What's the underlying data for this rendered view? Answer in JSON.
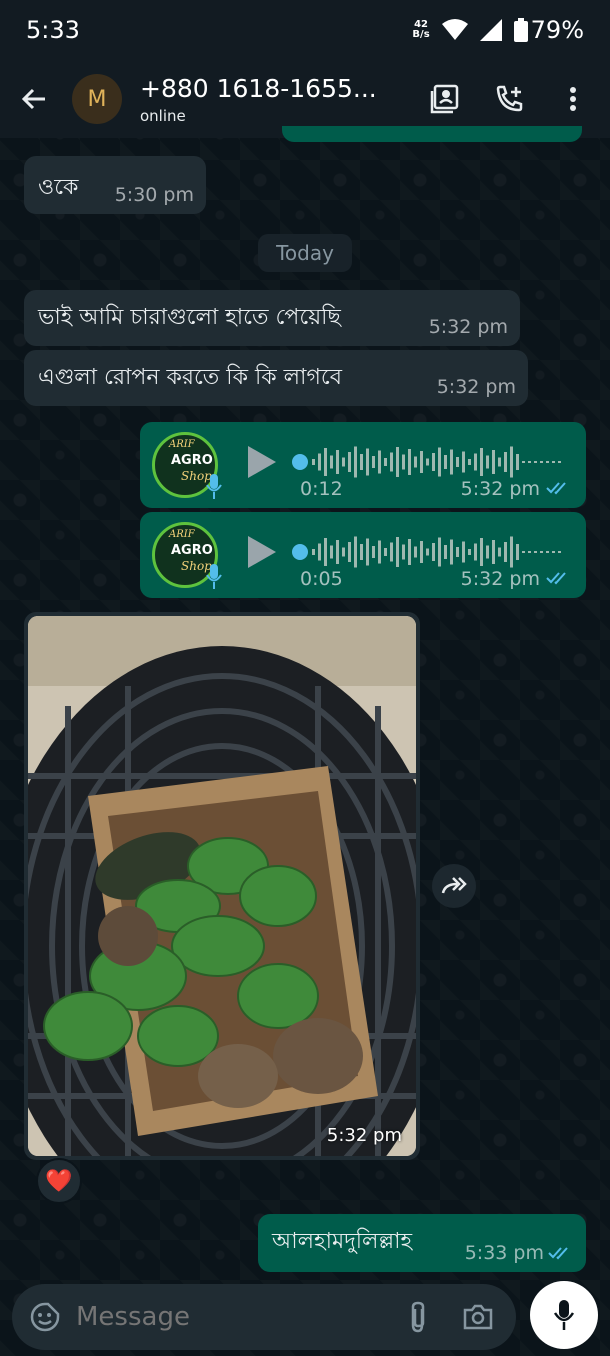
{
  "status_bar": {
    "time": "5:33",
    "net_speed_value": "42",
    "net_speed_unit": "B/s",
    "battery": "79%"
  },
  "header": {
    "avatar_letter": "M",
    "title": "+880 1618-1655...",
    "subtitle": "online"
  },
  "messages": {
    "m1": {
      "text": "ওকে",
      "time": "5:30 pm"
    },
    "date_chip": "Today",
    "m2": {
      "text": "ভাই আমি চারাগুলো হাতে পেয়েছি",
      "time": "5:32 pm"
    },
    "m3": {
      "text": "এগুলা রোপন করতে কি কি লাগবে",
      "time": "5:32 pm"
    },
    "voice1": {
      "duration": "0:12",
      "time": "5:32 pm"
    },
    "voice2": {
      "duration": "0:05",
      "time": "5:32 pm"
    },
    "photo": {
      "time": "5:32 pm",
      "reaction": "❤️"
    },
    "m4": {
      "text": "আলহামদুলিল্লাহ",
      "time": "5:33 pm"
    }
  },
  "voice_avatar": {
    "line1": "ARIF",
    "line2": "AGRO",
    "line3": "Shop"
  },
  "input": {
    "placeholder": "Message"
  },
  "colors": {
    "incoming": "#202c33",
    "outgoing": "#005c4b",
    "read_tick": "#53bdeb",
    "background": "#0b141a"
  }
}
